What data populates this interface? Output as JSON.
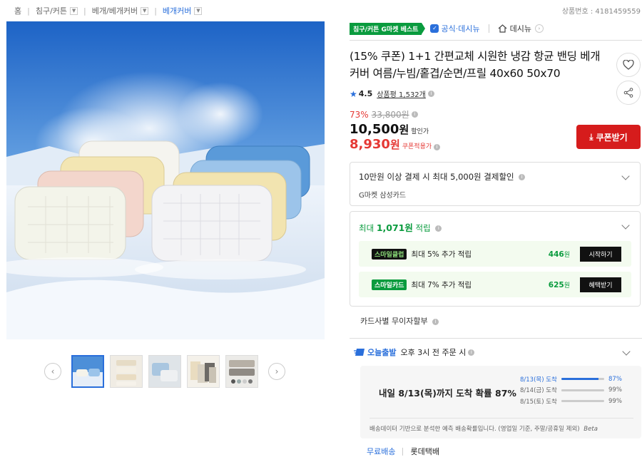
{
  "breadcrumb": {
    "home": "홈",
    "level1": "침구/커튼",
    "level2": "베개/베개커버",
    "level3": "베개커버"
  },
  "product_no": "상품번호 : 4181459559",
  "badges": {
    "best": "침구/커튼 G마켓 베스트",
    "official": "공식·데시뉴",
    "shop": "데시뉴"
  },
  "title": "(15% 쿠폰) 1+1 간편교체 시원한 냉감 항균 밴딩 베개커버 여름/누빔/홑겹/순면/프릴 40x60 50x70",
  "rating": {
    "score": "4.5",
    "reviews": "상품평 1,532개"
  },
  "price": {
    "discount_rate": "73%",
    "original": "33,800원",
    "sale_value": "10,500",
    "sale_unit": "원",
    "sale_label": "할인가",
    "coupon_value": "8,930",
    "coupon_unit": "원",
    "coupon_label": "쿠폰적용가",
    "coupon_button": "쿠폰받기"
  },
  "card_benefit": {
    "line1": "10만원 이상 결제 시 최대 5,000원 결제할인",
    "line2": "G마켓 삼성카드"
  },
  "points": {
    "head_prefix": "최대 ",
    "head_amount": "1,071원",
    "head_suffix": " 적립",
    "rows": [
      {
        "logo": "스마일클럽",
        "text": "최대 5% 추가 적립",
        "amount": "446",
        "unit": "원",
        "button": "시작하기"
      },
      {
        "logo": "스마일카드",
        "text": "최대 7% 추가 적립",
        "amount": "625",
        "unit": "원",
        "button": "혜택받기"
      }
    ]
  },
  "installment": "카드사별 무이자할부",
  "shipping": {
    "today_label": "오늘출발",
    "today_text": "오후 3시 전 주문 시",
    "probability": "내일 8/13(목)까지 도착 확률 87%",
    "rows": [
      {
        "date": "8/13(목) 도착",
        "pct": "87%",
        "level": 0.87
      },
      {
        "date": "8/14(금) 도착",
        "pct": "99%",
        "level": 0.99
      },
      {
        "date": "8/15(토) 도착",
        "pct": "99%",
        "level": 0.99
      }
    ],
    "note": "배송데이터 기반으로 분석한 예측 배송확률입니다. (영업일 기준, 주말/공휴일 제외)",
    "note_tag": "Beta",
    "free": "무료배송",
    "carrier": "롯데택배"
  },
  "colors": {
    "accent_blue": "#2a6fdb",
    "sale_red": "#e53935",
    "coupon_red": "#d61c1c",
    "green": "#0a9b3e"
  }
}
